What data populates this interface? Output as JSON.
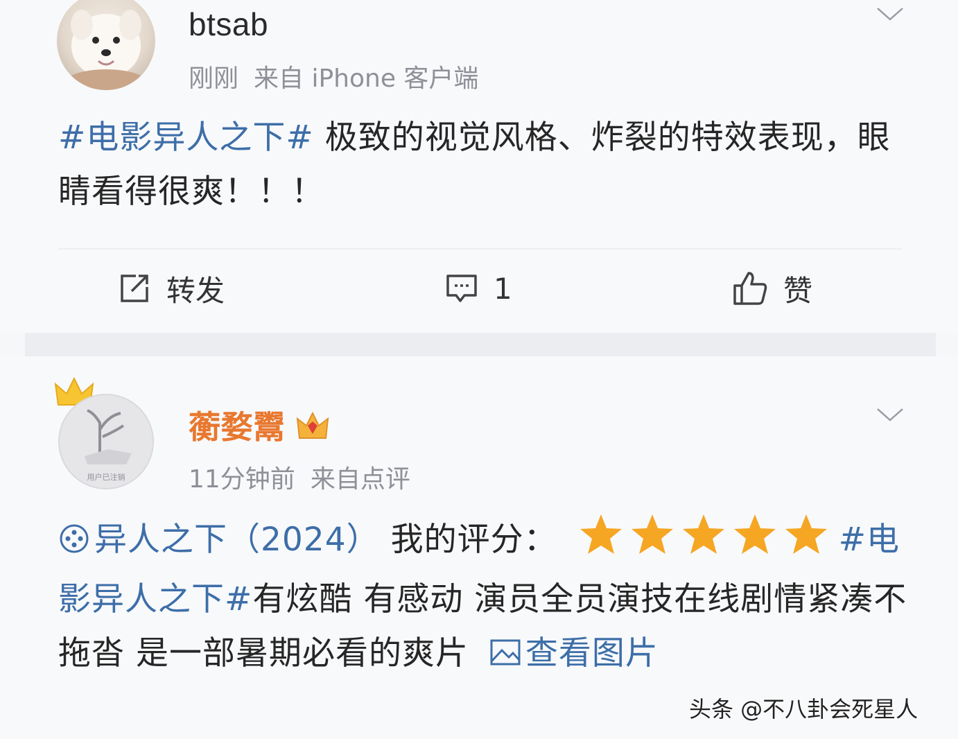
{
  "posts": [
    {
      "username": "btsab",
      "time": "刚刚",
      "source": "来自 iPhone 客户端",
      "tag": "#电影异人之下#",
      "text": " 极致的视觉风格、炸裂的特效表现，眼睛看得很爽！！！",
      "actions": {
        "repost": "转发",
        "comment_count": "1",
        "like": "赞"
      }
    },
    {
      "username": "蘅婺鬻",
      "time": "11分钟前",
      "source": "来自点评",
      "movie_link": "异人之下（2024）",
      "rating_label": " 我的评分：",
      "rating_stars": 5,
      "tag_start": "#",
      "tag_rest": "电影异人之下#",
      "text": "有炫酷 有感动 演员全员演技在线剧情紧凑不拖沓 是一部暑期必看的爽片 ",
      "view_image": "查看图片",
      "avatar_text": "用户已注销"
    }
  ],
  "watermark": "头条 @不八卦会死星人",
  "colors": {
    "link": "#3d6ea8",
    "username_vip": "#e8782f",
    "star": "#f5a623"
  }
}
